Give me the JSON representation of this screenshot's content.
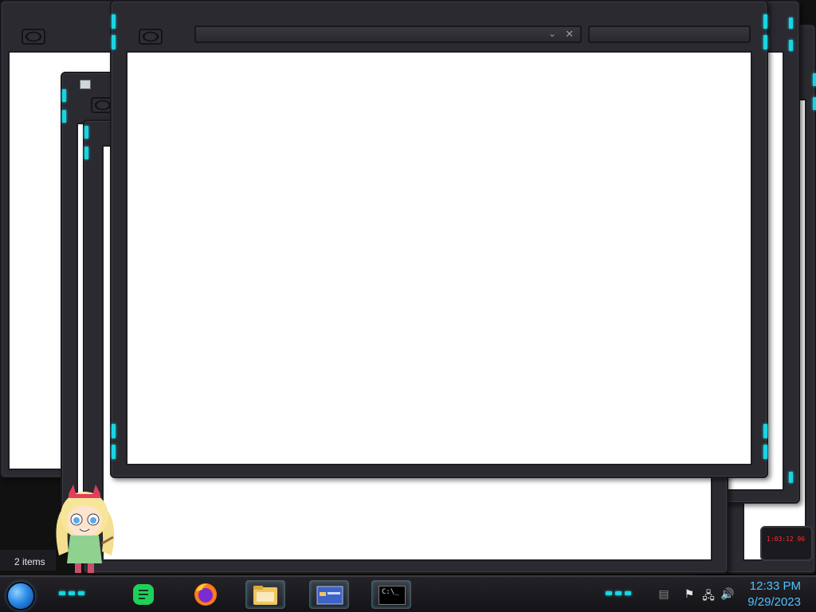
{
  "taskbar": {
    "start_button": "start-orb",
    "pinned_apps": [
      {
        "name": "Notes",
        "icon": "notes-icon"
      },
      {
        "name": "Firefox",
        "icon": "firefox-icon"
      },
      {
        "name": "File Explorer",
        "icon": "folder-icon"
      },
      {
        "name": "Control Panel",
        "icon": "control-panel-icon"
      },
      {
        "name": "Command Prompt",
        "icon": "terminal-icon",
        "glyph": "C:\\_"
      }
    ],
    "tray": {
      "flag": "flag-icon",
      "network": "network-icon",
      "volume": "volume-icon"
    },
    "clock": {
      "time": "12:33 PM",
      "date": "9/29/2023"
    }
  },
  "explorer_status": {
    "items_count": "2 items"
  },
  "widget": {
    "text": "1:03:12 96"
  },
  "colors": {
    "accent_cyan": "#19d4e2",
    "clock_blue": "#4fc3ff",
    "frame_dark": "#2b2a30",
    "content_white": "#ffffff"
  }
}
